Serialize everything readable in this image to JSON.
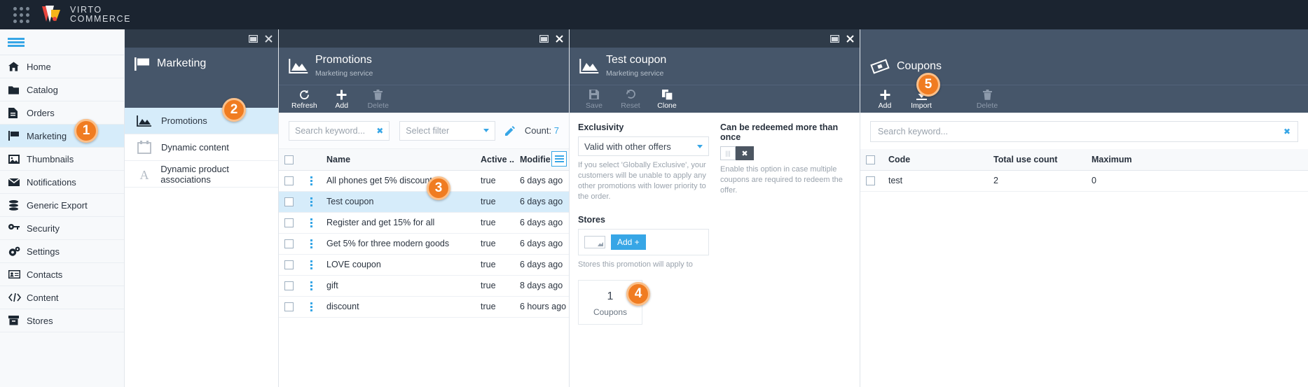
{
  "topbar": {
    "brand_line1": "VIRTO",
    "brand_line2": "COMMERCE"
  },
  "sidebar": {
    "items": [
      {
        "label": "Home",
        "icon": "home-icon"
      },
      {
        "label": "Catalog",
        "icon": "folder-icon"
      },
      {
        "label": "Orders",
        "icon": "document-icon"
      },
      {
        "label": "Marketing",
        "icon": "flag-icon"
      },
      {
        "label": "Thumbnails",
        "icon": "image-icon"
      },
      {
        "label": "Notifications",
        "icon": "envelope-icon"
      },
      {
        "label": "Generic Export",
        "icon": "database-icon"
      },
      {
        "label": "Security",
        "icon": "key-icon"
      },
      {
        "label": "Settings",
        "icon": "gears-icon"
      },
      {
        "label": "Contacts",
        "icon": "contact-card-icon"
      },
      {
        "label": "Content",
        "icon": "code-icon"
      },
      {
        "label": "Stores",
        "icon": "store-icon"
      }
    ]
  },
  "marketing": {
    "title": "Marketing",
    "items": [
      {
        "label": "Promotions"
      },
      {
        "label": "Dynamic content"
      },
      {
        "label": "Dynamic product associations"
      }
    ]
  },
  "promotions": {
    "title": "Promotions",
    "subtitle": "Marketing service",
    "toolbar": {
      "refresh": "Refresh",
      "add": "Add",
      "delete": "Delete"
    },
    "search_placeholder": "Search keyword...",
    "filter_placeholder": "Select filter",
    "count_label": "Count:",
    "count_value": "7",
    "columns": [
      "Name",
      "Active ...",
      "Modifie"
    ],
    "rows": [
      {
        "name": "All phones get 5% discount",
        "active": "true",
        "modified": "6 days ago"
      },
      {
        "name": "Test coupon",
        "active": "true",
        "modified": "6 days ago"
      },
      {
        "name": "Register and get 15% for all",
        "active": "true",
        "modified": "6 days ago"
      },
      {
        "name": "Get 5% for three modern goods",
        "active": "true",
        "modified": "6 days ago"
      },
      {
        "name": "LOVE coupon",
        "active": "true",
        "modified": "6 days ago"
      },
      {
        "name": "gift",
        "active": "true",
        "modified": "8 days ago"
      },
      {
        "name": "discount",
        "active": "true",
        "modified": "6 hours ago"
      }
    ]
  },
  "coupon_blade": {
    "title": "Test coupon",
    "subtitle": "Marketing service",
    "toolbar": {
      "save": "Save",
      "reset": "Reset",
      "clone": "Clone"
    },
    "exclusivity_label": "Exclusivity",
    "exclusivity_value": "Valid with other offers",
    "exclusivity_hint": "If you select 'Globally Exclusive', your customers will be unable to apply any other promotions with lower priority to the order.",
    "redeem_label": "Can be redeemed more than once",
    "redeem_hint": "Enable this option in case multiple coupons are required to redeem the offer.",
    "stores_label": "Stores",
    "stores_add": "Add +",
    "stores_hint": "Stores this promotion will apply to",
    "tile_number": "1",
    "tile_label": "Coupons"
  },
  "coupons_blade": {
    "title": "Coupons",
    "toolbar": {
      "add": "Add",
      "import": "Import",
      "delete": "Delete"
    },
    "search_placeholder": "Search keyword...",
    "columns": [
      "Code",
      "Total use count",
      "Maximum"
    ],
    "rows": [
      {
        "code": "test",
        "total_use_count": "2",
        "maximum": "0"
      }
    ]
  },
  "badges": [
    "1",
    "2",
    "3",
    "4",
    "5"
  ],
  "colors": {
    "accent": "#37a6e6",
    "badge": "#f07c21",
    "selection": "#d6ecfa",
    "blade_header": "#46566a"
  }
}
